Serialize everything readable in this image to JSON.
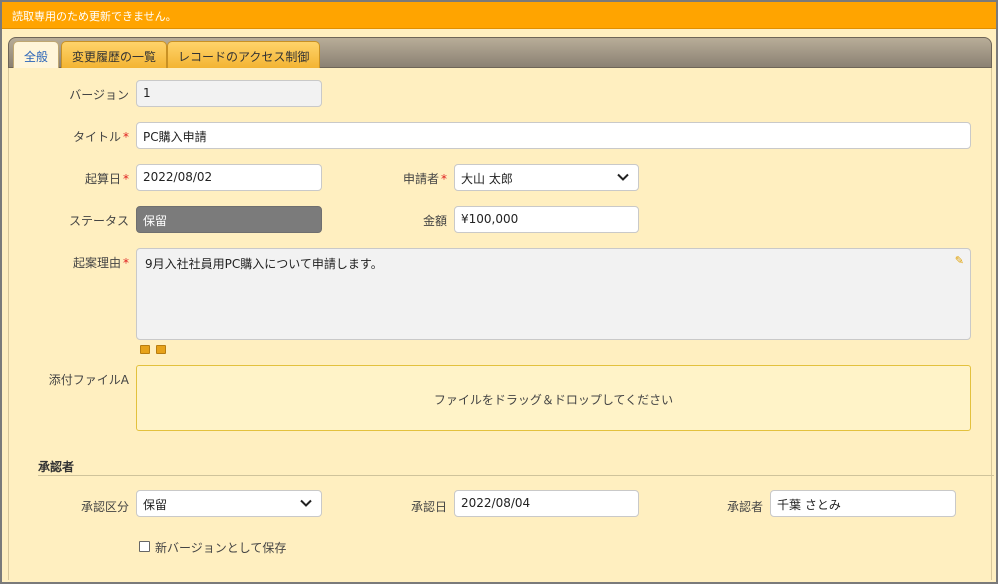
{
  "notice": "読取専用のため更新できません。",
  "tabs": [
    {
      "label": "全般"
    },
    {
      "label": "変更履歴の一覧"
    },
    {
      "label": "レコードのアクセス制御"
    }
  ],
  "form": {
    "version": {
      "label": "バージョン",
      "value": "1"
    },
    "title": {
      "label": "タイトル",
      "required": "*",
      "value": "PC購入申請"
    },
    "draft_date": {
      "label": "起算日",
      "required": "*",
      "value": "2022/08/02"
    },
    "applicant": {
      "label": "申請者",
      "required": "*",
      "value": "大山 太郎"
    },
    "status": {
      "label": "ステータス",
      "value": "保留"
    },
    "amount": {
      "label": "金額",
      "value": "¥100,000"
    },
    "reason": {
      "label": "起案理由",
      "required": "*",
      "value": "9月入社社員用PC購入について申請します。"
    },
    "attachment": {
      "label": "添付ファイルA",
      "placeholder": "ファイルをドラッグ＆ドロップしてください"
    }
  },
  "approver_section": {
    "title": "承認者",
    "category": {
      "label": "承認区分",
      "value": "保留"
    },
    "approval_date": {
      "label": "承認日",
      "value": "2022/08/04"
    },
    "approver": {
      "label": "承認者",
      "value": "千葉 さとみ"
    },
    "save_new_version": {
      "label": "新バージョンとして保存",
      "checked": false
    }
  },
  "colors": {
    "notice_bg": "#ffa400",
    "panel_bg": "#ffefc0",
    "tab_active_text": "#2a64b8",
    "required": "#e02020"
  },
  "icons": [
    "chevron-down-icon",
    "pencil-icon",
    "image-icon",
    "table-icon"
  ]
}
